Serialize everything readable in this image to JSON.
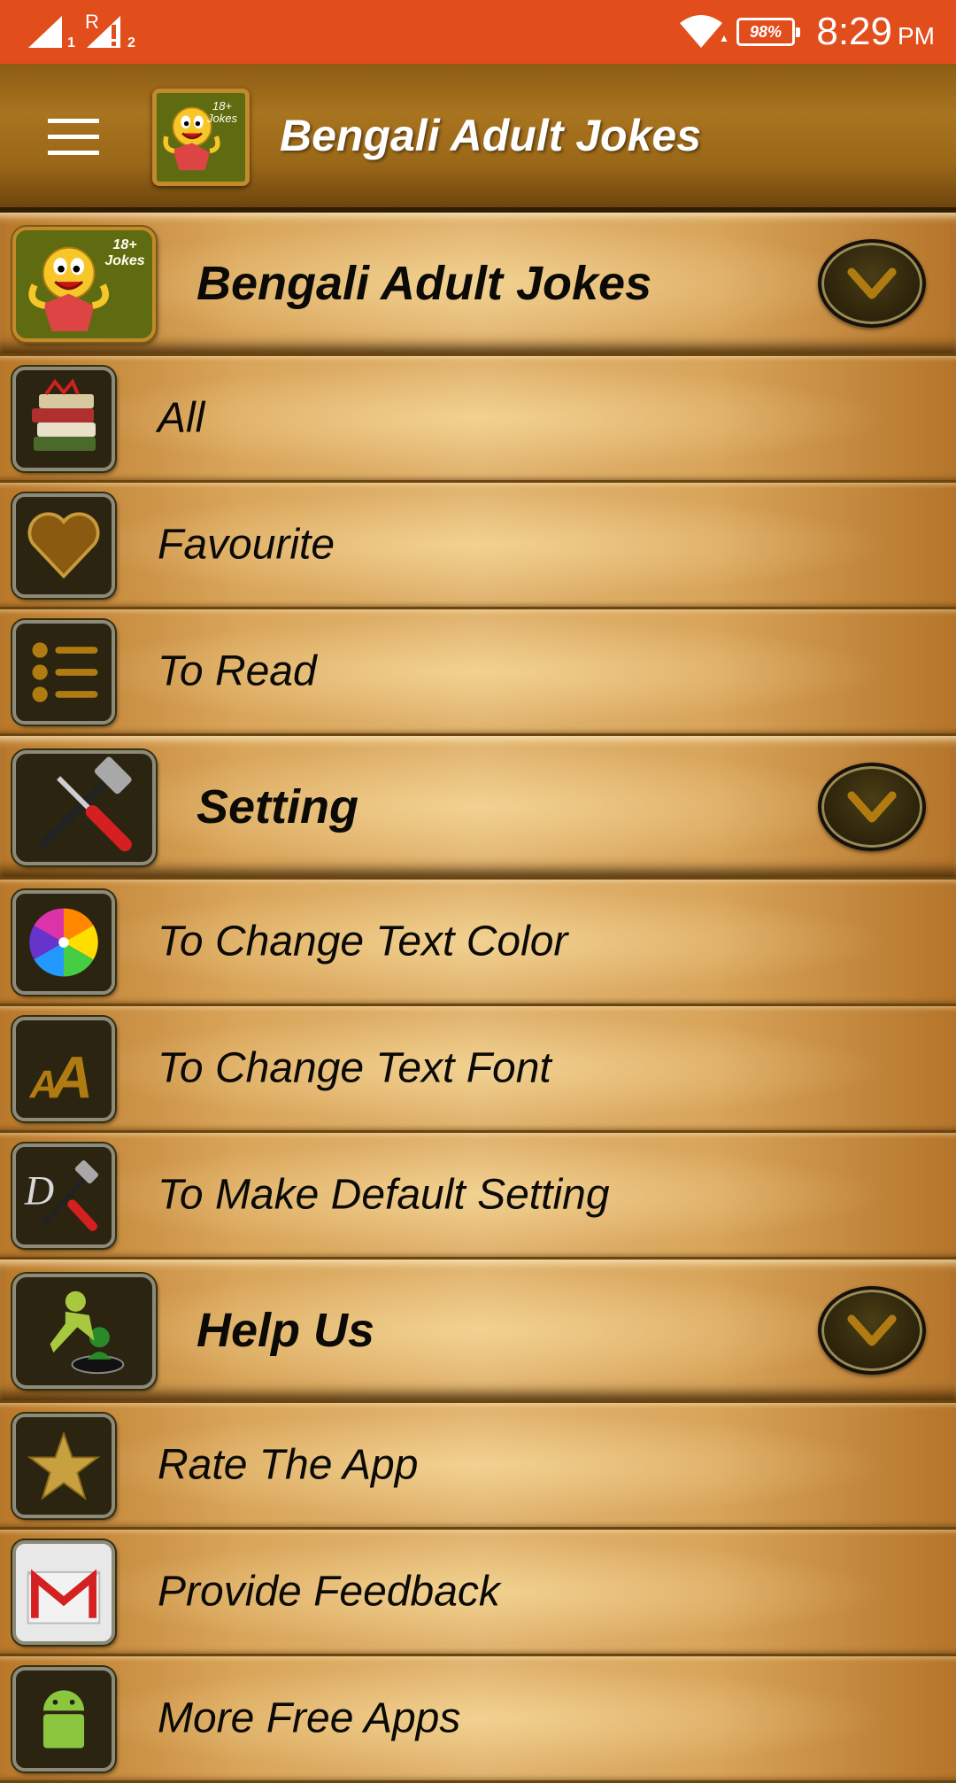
{
  "status_bar": {
    "battery": "98%",
    "time": "8:29",
    "ampm": "PM",
    "sim1": "1",
    "sim2": "2",
    "roaming": "R"
  },
  "app_bar": {
    "title": "Bengali Adult Jokes",
    "logo_text": "18+ Jokes"
  },
  "sections": [
    {
      "header": "Bengali Adult Jokes",
      "items": [
        "All",
        "Favourite",
        "To Read"
      ]
    },
    {
      "header": "Setting",
      "items": [
        "To Change Text Color",
        "To Change Text Font",
        "To Make Default Setting"
      ]
    },
    {
      "header": "Help Us",
      "items": [
        "Rate The App",
        "Provide Feedback",
        "More Free Apps"
      ]
    }
  ],
  "colors": {
    "status_bar": "#e24d1c",
    "app_bar": "#9a6718",
    "list_bg": "#d9a55a",
    "text": "#0c0a06",
    "icon_gold": "#b07c12"
  }
}
